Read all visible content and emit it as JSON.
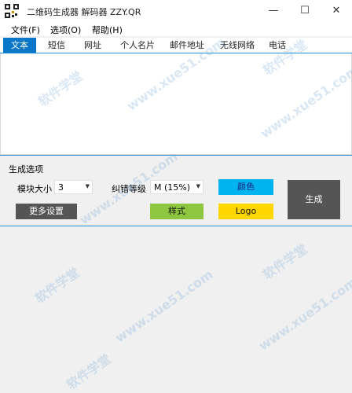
{
  "window": {
    "title": "二维码生成器 解码器 ZZY.QR",
    "controls": {
      "minimize": "—",
      "maximize": "☐",
      "close": "✕"
    }
  },
  "menu": {
    "file": "文件(F)",
    "options": "选项(O)",
    "help": "帮助(H)"
  },
  "tabs": [
    "文本",
    "短信",
    "网址",
    "个人名片",
    "邮件地址",
    "无线网络",
    "电话"
  ],
  "text_input": {
    "value": ""
  },
  "options": {
    "section_title": "生成选项",
    "module_size_label": "模块大小",
    "module_size_value": "3",
    "ecc_label": "纠错等级",
    "ecc_value": "M (15%)",
    "color_button": "颜色",
    "generate_button": "生成",
    "more_settings_button": "更多设置",
    "style_button": "样式",
    "logo_button": "Logo"
  },
  "colors": {
    "accent_tab": "#0a77c8",
    "color_button_bg": "#00b4f0",
    "generate_bg": "#555555",
    "more_settings_bg": "#555555",
    "style_bg": "#8ec63f",
    "logo_bg": "#ffd700"
  },
  "watermarks": [
    "软件学堂",
    "www.xue51.com"
  ]
}
